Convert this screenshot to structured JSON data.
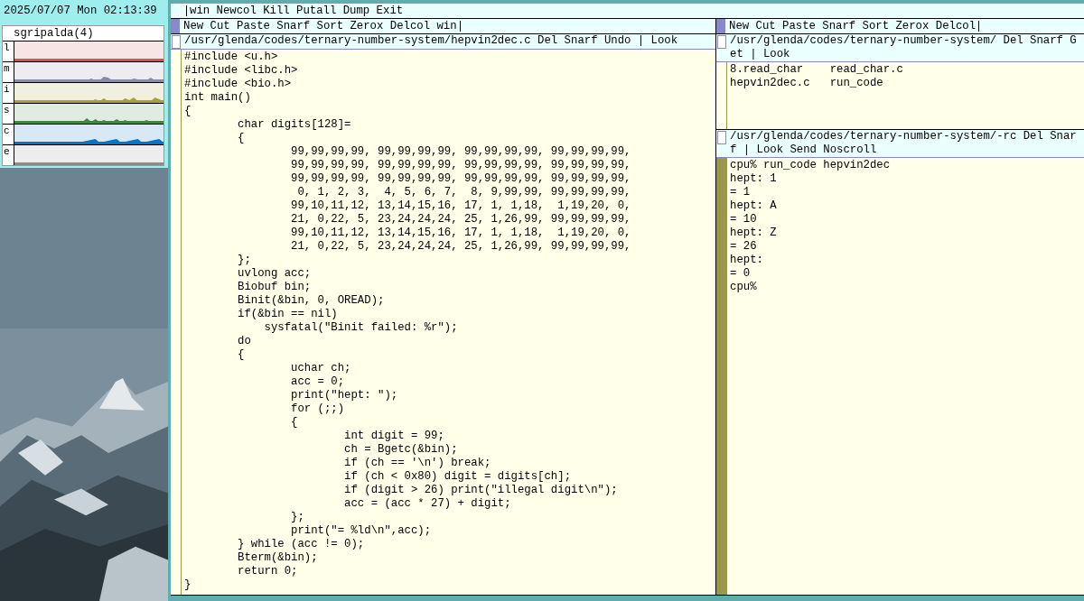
{
  "clock": "2025/07/07 Mon 02:13:39",
  "stats": {
    "title": "sgripalda(4)",
    "meters": [
      {
        "label": "l",
        "color": "#cc5555"
      },
      {
        "label": "m",
        "color": "#8a8aa8"
      },
      {
        "label": "i",
        "color": "#a8a040"
      },
      {
        "label": "s",
        "color": "#3d8a3d"
      },
      {
        "label": "c",
        "color": "#0a74c4"
      },
      {
        "label": "e",
        "color": "#8c8c8c"
      }
    ]
  },
  "acme": {
    "tag": "win Newcol Kill Putall Dump Exit",
    "columns": [
      {
        "tag": "New Cut Paste Snarf Sort Zerox Delcol win",
        "windows": [
          {
            "kind": "code",
            "tag": "/usr/glenda/codes/ternary-number-system/hepvin2dec.c Del Snarf Undo | Look",
            "lines": [
              "#include <u.h>",
              "#include <libc.h>",
              "#include <bio.h>",
              "int main()",
              "{",
              "\tchar digits[128]=",
              "\t{",
              "\t\t99,99,99,99, 99,99,99,99, 99,99,99,99, 99,99,99,99,",
              "\t\t99,99,99,99, 99,99,99,99, 99,99,99,99, 99,99,99,99,",
              "\t\t99,99,99,99, 99,99,99,99, 99,99,99,99, 99,99,99,99,",
              "\t\t 0, 1, 2, 3,  4, 5, 6, 7,  8, 9,99,99, 99,99,99,99,",
              "\t\t99,10,11,12, 13,14,15,16, 17, 1, 1,18,  1,19,20, 0,",
              "\t\t21, 0,22, 5, 23,24,24,24, 25, 1,26,99, 99,99,99,99,",
              "\t\t99,10,11,12, 13,14,15,16, 17, 1, 1,18,  1,19,20, 0,",
              "\t\t21, 0,22, 5, 23,24,24,24, 25, 1,26,99, 99,99,99,99,",
              "\t};",
              "\tuvlong acc;",
              "\tBiobuf bin;",
              "\tBinit(&bin, 0, OREAD);",
              "\tif(&bin == nil)",
              "\t    sysfatal(\"Binit failed: %r\");",
              "\tdo",
              "\t{",
              "\t\tuchar ch;",
              "\t\tacc = 0;",
              "\t\tprint(\"hept: \");",
              "\t\tfor (;;)",
              "\t\t{",
              "\t\t\tint digit = 99;",
              "\t\t\tch = Bgetc(&bin);",
              "\t\t\tif (ch == '\\n') break;",
              "\t\t\tif (ch < 0x80) digit = digits[ch];",
              "\t\t\tif (digit > 26) print(\"illegal digit\\n\");",
              "\t\t\tacc = (acc * 27) + digit;",
              "\t\t};",
              "\t\tprint(\"= %ld\\n\",acc);",
              "\t} while (acc != 0);",
              "\tBterm(&bin);",
              "\treturn 0;",
              "}"
            ]
          }
        ]
      },
      {
        "tag": "New Cut Paste Snarf Sort Zerox Delcol",
        "windows": [
          {
            "kind": "directory",
            "tag": "/usr/glenda/codes/ternary-number-system/ Del Snarf Get | Look",
            "lines": [
              "8.read_char",
              "read_char.c",
              "hepvin2dec.c",
              "run_code"
            ]
          },
          {
            "kind": "shell",
            "tag": "/usr/glenda/codes/ternary-number-system/-rc Del Snarf | Look Send Noscroll",
            "lines": [
              "cpu% run_code hepvin2dec",
              "hept: 1",
              "= 1",
              "hept: A",
              "= 10",
              "hept: Z",
              "= 26",
              "hept: ",
              "= 0",
              "cpu% "
            ]
          }
        ]
      }
    ]
  }
}
